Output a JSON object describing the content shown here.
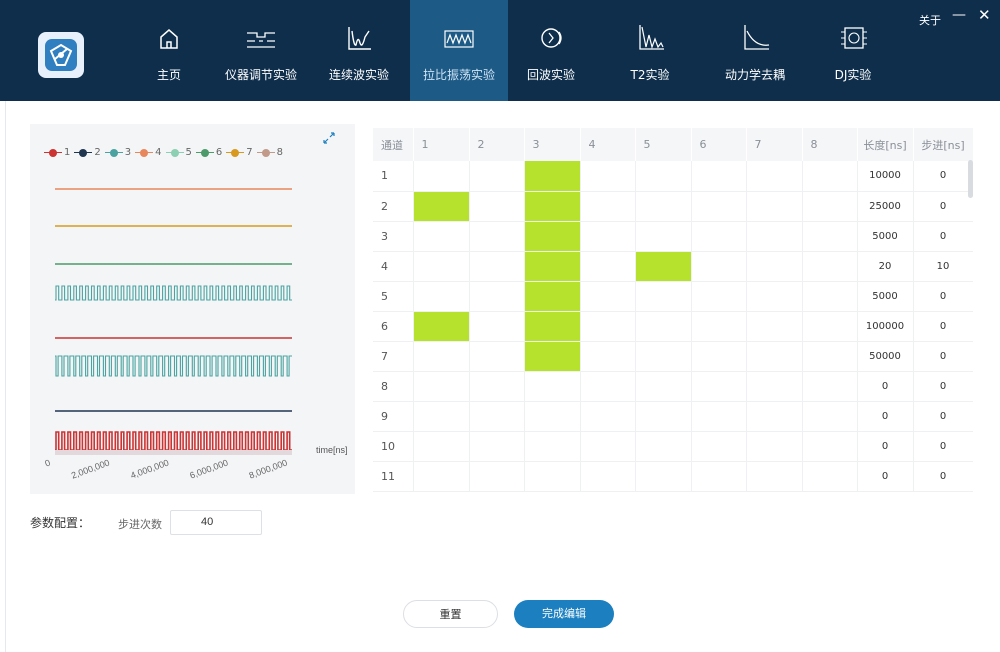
{
  "header": {
    "nav": [
      {
        "label": "主页",
        "icon": "home-icon"
      },
      {
        "label": "仪器调节实验",
        "icon": "instrument-icon"
      },
      {
        "label": "连续波实验",
        "icon": "continuous-wave-icon"
      },
      {
        "label": "拉比振荡实验",
        "icon": "rabi-oscillation-icon",
        "active": true
      },
      {
        "label": "回波实验",
        "icon": "echo-icon"
      },
      {
        "label": "T2实验",
        "icon": "t2-icon"
      },
      {
        "label": "动力学去耦",
        "icon": "dynamical-decoupling-icon"
      },
      {
        "label": "DJ实验",
        "icon": "dj-chip-icon"
      }
    ],
    "about": "关于",
    "minimize": "—",
    "close": "✕"
  },
  "chart": {
    "legend": [
      "1",
      "2",
      "3",
      "4",
      "5",
      "6",
      "7",
      "8"
    ],
    "colors": [
      "#cc3333",
      "#1f3550",
      "#4aa3a1",
      "#e8875c",
      "#8dcfb3",
      "#4d9a6a",
      "#d8991f",
      "#c29a8a"
    ],
    "x_ticks": [
      "0",
      "2,000,000",
      "4,000,000",
      "6,000,000",
      "8,000,000"
    ],
    "x_unit": "time[ns]"
  },
  "table": {
    "headers": [
      "通道",
      "1",
      "2",
      "3",
      "4",
      "5",
      "6",
      "7",
      "8",
      "长度[ns]",
      "步进[ns]"
    ],
    "rows": [
      {
        "id": "1",
        "on": [
          3
        ],
        "length": "10000",
        "step": "0"
      },
      {
        "id": "2",
        "on": [
          1,
          3
        ],
        "length": "25000",
        "step": "0"
      },
      {
        "id": "3",
        "on": [
          3
        ],
        "length": "5000",
        "step": "0"
      },
      {
        "id": "4",
        "on": [
          3,
          5
        ],
        "length": "20",
        "step": "10"
      },
      {
        "id": "5",
        "on": [
          3
        ],
        "length": "5000",
        "step": "0"
      },
      {
        "id": "6",
        "on": [
          1,
          3
        ],
        "length": "100000",
        "step": "0"
      },
      {
        "id": "7",
        "on": [
          3
        ],
        "length": "50000",
        "step": "0"
      },
      {
        "id": "8",
        "on": [],
        "length": "0",
        "step": "0"
      },
      {
        "id": "9",
        "on": [],
        "length": "0",
        "step": "0"
      },
      {
        "id": "10",
        "on": [],
        "length": "0",
        "step": "0"
      },
      {
        "id": "11",
        "on": [],
        "length": "0",
        "step": "0"
      }
    ],
    "active_color": "#b6e22e"
  },
  "params": {
    "title": "参数配置：",
    "step_count_label": "步进次数",
    "step_count_value": "40"
  },
  "buttons": {
    "reset": "重置",
    "done": "完成编辑"
  }
}
